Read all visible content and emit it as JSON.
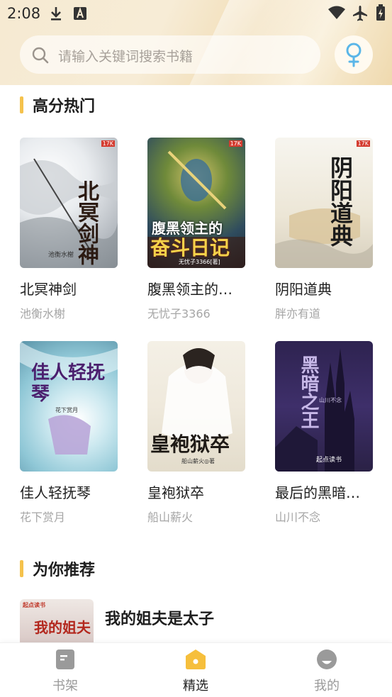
{
  "status_bar": {
    "time": "2:08"
  },
  "search": {
    "placeholder": "请输入关键词搜索书籍"
  },
  "accent_color": "#f5c24c",
  "sections": {
    "hot": {
      "title": "高分热门"
    },
    "recommend": {
      "title": "为你推荐"
    }
  },
  "books": [
    {
      "title": "北冥神剑",
      "author": "池衡水榭",
      "cover_text": "北冥剑神",
      "cover_author": "池衡水榭"
    },
    {
      "title": "腹黑领主的…",
      "author": "无忧子3366",
      "cover_text_top": "腹黑领主的",
      "cover_text_bottom": "奋斗日记",
      "cover_author": "无忧子3366[著]"
    },
    {
      "title": "阴阳道典",
      "author": "胖亦有道",
      "cover_text": "阴阳道典"
    },
    {
      "title": "佳人轻抚琴",
      "author": "花下赏月",
      "cover_text": "佳人轻抚琴",
      "cover_author": "花下赏月"
    },
    {
      "title": "皇袍狱卒",
      "author": "船山薪火",
      "cover_text": "皇袍狱卒",
      "cover_author": "船山薪火◎著"
    },
    {
      "title": "最后的黑暗…",
      "author": "山川不念",
      "cover_text": "黑暗之王",
      "cover_author": "山川不念",
      "cover_brand": "起点读书"
    }
  ],
  "cover_badge": "17K",
  "recommended": [
    {
      "title": "我的姐夫是太子",
      "cover_brand": "起点读书",
      "cover_text": "我的姐夫"
    }
  ],
  "bottom_nav": [
    {
      "label": "书架",
      "icon": "bookshelf-icon",
      "active": false
    },
    {
      "label": "精选",
      "icon": "featured-icon",
      "active": true
    },
    {
      "label": "我的",
      "icon": "profile-icon",
      "active": false
    }
  ]
}
